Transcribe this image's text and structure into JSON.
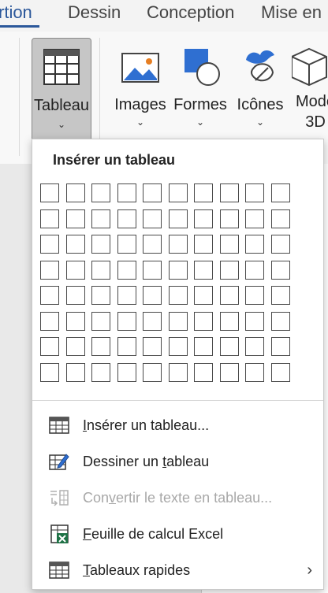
{
  "ribbon_tabs": [
    {
      "label": "rtion"
    },
    {
      "label": "Dessin"
    },
    {
      "label": "Conception"
    },
    {
      "label": "Mise en"
    }
  ],
  "ribbon": {
    "tableau_label": "Tableau",
    "images_label": "Images",
    "formes_label": "Formes",
    "icones_label": "Icônes",
    "modeles_label_line1": "Mode",
    "modeles_label_line2": "3D"
  },
  "insert_table_menu": {
    "title": "Insérer un tableau",
    "grid_columns": 10,
    "grid_rows": 8,
    "items": [
      {
        "pre": "",
        "mnemonic": "I",
        "post": "nsérer un tableau...",
        "enabled": true,
        "icon": "table-icon"
      },
      {
        "pre": "Dessiner un ",
        "mnemonic": "t",
        "post": "ableau",
        "enabled": true,
        "icon": "draw-table-icon"
      },
      {
        "pre": "Con",
        "mnemonic": "v",
        "post": "ertir le texte en tableau...",
        "enabled": false,
        "icon": "convert-text-to-table-icon"
      },
      {
        "pre": "",
        "mnemonic": "F",
        "post": "euille de calcul Excel",
        "enabled": true,
        "icon": "excel-sheet-icon"
      },
      {
        "pre": "",
        "mnemonic": "T",
        "post": "ableaux rapides",
        "enabled": true,
        "icon": "quick-tables-icon",
        "submenu_arrow": "›"
      }
    ]
  },
  "colors": {
    "accent": "#2b579a",
    "excel_green": "#1e7145",
    "image_blue": "#2f6fd1"
  }
}
